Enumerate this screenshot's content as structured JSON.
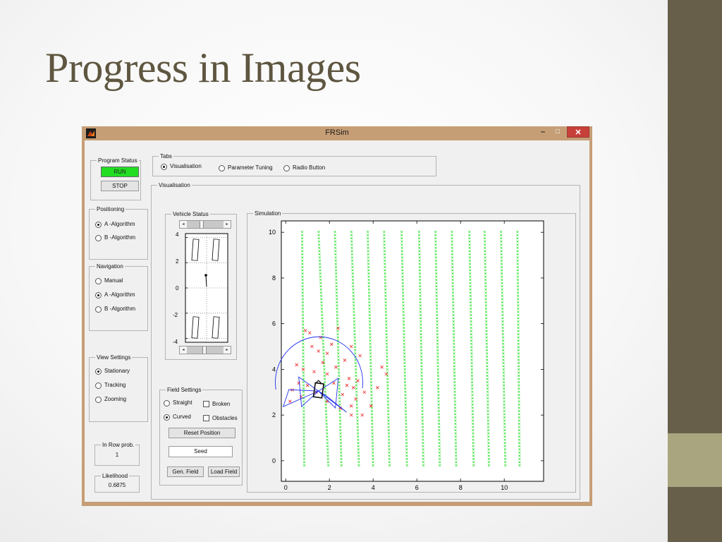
{
  "slide": {
    "title": "Progress in Images"
  },
  "window": {
    "title": "FRSim",
    "minimize_glyph": "–",
    "maximize_glyph": "□",
    "close_glyph": "✕"
  },
  "program_status": {
    "title": "Program Status",
    "status": "RUN",
    "stop_label": "STOP",
    "status_color": "#22dd22"
  },
  "positioning": {
    "title": "Positioning",
    "options": [
      "A -Algorithm",
      "B -Algorithm"
    ],
    "selected": 0
  },
  "navigation": {
    "title": "Navigation",
    "options": [
      "Manual",
      "A -Algorithm",
      "B -Algorithm"
    ],
    "selected": 1
  },
  "view_settings": {
    "title": "View Settings",
    "options": [
      "Stationary",
      "Tracking",
      "Zooming"
    ],
    "selected": 0
  },
  "in_row_prob": {
    "title": "In Row prob.",
    "value": "1"
  },
  "likelihood": {
    "title": "Likelihood",
    "value": "0.6875"
  },
  "tabs": {
    "title": "Tabs",
    "options": [
      "Visualisation",
      "Parameter Tuning",
      "Radio Button"
    ],
    "selected": 0
  },
  "visualisation": {
    "title": "Visualisation"
  },
  "vehicle_status": {
    "title": "Vehicle Status",
    "y_ticks": [
      "4",
      "2",
      "0",
      "-2",
      "-4"
    ],
    "slider_glyph_left": "◂",
    "slider_glyph_right": "▸"
  },
  "field_settings": {
    "title": "Field Settings",
    "shape_options": [
      "Straight",
      "Curved"
    ],
    "shape_selected": 1,
    "broken_label": "Broken",
    "broken_checked": false,
    "obstacles_label": "Obstacles",
    "obstacles_checked": false,
    "reset_label": "Reset Position",
    "seed_value": "Seed",
    "gen_field_label": "Gen. Field",
    "load_field_label": "Load Field"
  },
  "simulation": {
    "title": "Simulation"
  },
  "chart_data": {
    "type": "scatter",
    "title": "",
    "xlabel": "",
    "ylabel": "",
    "xlim": [
      -0.2,
      11.8
    ],
    "ylim": [
      -0.9,
      10.5
    ],
    "x_ticks": [
      0,
      2,
      4,
      6,
      8,
      10
    ],
    "y_ticks": [
      0,
      2,
      4,
      6,
      8,
      10
    ],
    "grid": false,
    "series": [
      {
        "marker": "x",
        "color": "#22dd22",
        "rows": [
          {
            "x_top": 0.75,
            "x_bottom": 0.85
          },
          {
            "x_top": 1.5,
            "x_bottom": 1.95
          },
          {
            "x_top": 2.25,
            "x_bottom": 2.55
          },
          {
            "x_top": 3.0,
            "x_bottom": 3.35
          },
          {
            "x_top": 3.75,
            "x_bottom": 4.0
          },
          {
            "x_top": 4.5,
            "x_bottom": 4.75
          },
          {
            "x_top": 5.3,
            "x_bottom": 5.55
          },
          {
            "x_top": 6.1,
            "x_bottom": 6.3
          },
          {
            "x_top": 6.85,
            "x_bottom": 7.05
          },
          {
            "x_top": 7.6,
            "x_bottom": 7.8
          },
          {
            "x_top": 8.4,
            "x_bottom": 8.6
          },
          {
            "x_top": 9.1,
            "x_bottom": 9.3
          },
          {
            "x_top": 9.85,
            "x_bottom": 10.05
          },
          {
            "x_top": 10.6,
            "x_bottom": 10.7
          }
        ],
        "y_range": [
          -0.2,
          10.1
        ]
      },
      {
        "marker": "x",
        "color": "#ee2222",
        "points": [
          [
            0.9,
            5.7
          ],
          [
            1.1,
            5.6
          ],
          [
            1.6,
            5.4
          ],
          [
            2.4,
            5.8
          ],
          [
            1.2,
            5.0
          ],
          [
            1.5,
            4.8
          ],
          [
            1.9,
            4.7
          ],
          [
            2.1,
            5.1
          ],
          [
            2.7,
            4.4
          ],
          [
            3.0,
            5.0
          ],
          [
            3.4,
            4.6
          ],
          [
            0.5,
            4.2
          ],
          [
            0.8,
            4.0
          ],
          [
            1.3,
            3.9
          ],
          [
            1.9,
            3.8
          ],
          [
            2.3,
            4.1
          ],
          [
            2.9,
            3.6
          ],
          [
            3.1,
            3.2
          ],
          [
            3.3,
            3.5
          ],
          [
            3.6,
            3.0
          ],
          [
            4.2,
            3.2
          ],
          [
            4.6,
            3.8
          ],
          [
            0.3,
            3.1
          ],
          [
            0.6,
            3.4
          ],
          [
            1.0,
            3.3
          ],
          [
            1.4,
            3.0
          ],
          [
            2.6,
            2.9
          ],
          [
            2.8,
            3.3
          ],
          [
            3.2,
            2.7
          ],
          [
            3.0,
            2.4
          ],
          [
            2.5,
            2.3
          ],
          [
            1.9,
            2.6
          ],
          [
            0.2,
            2.6
          ],
          [
            0.7,
            2.8
          ],
          [
            3.5,
            2.0
          ],
          [
            3.0,
            2.0
          ],
          [
            3.9,
            2.4
          ],
          [
            4.4,
            4.1
          ],
          [
            2.2,
            3.4
          ],
          [
            1.7,
            4.3
          ]
        ]
      }
    ],
    "annotations": {
      "arc_center": [
        1.55,
        3.3
      ],
      "arc_radius": 2.0,
      "arc_color": "#2233ee",
      "vehicle": [
        1.5,
        3.05
      ],
      "vehicle_color": "#111111"
    }
  },
  "vehicle_chart": {
    "type": "scatter",
    "ylim": [
      -4.3,
      4.3
    ],
    "y_ticks": [
      4,
      2,
      0,
      -2,
      -4
    ],
    "grid": true
  }
}
